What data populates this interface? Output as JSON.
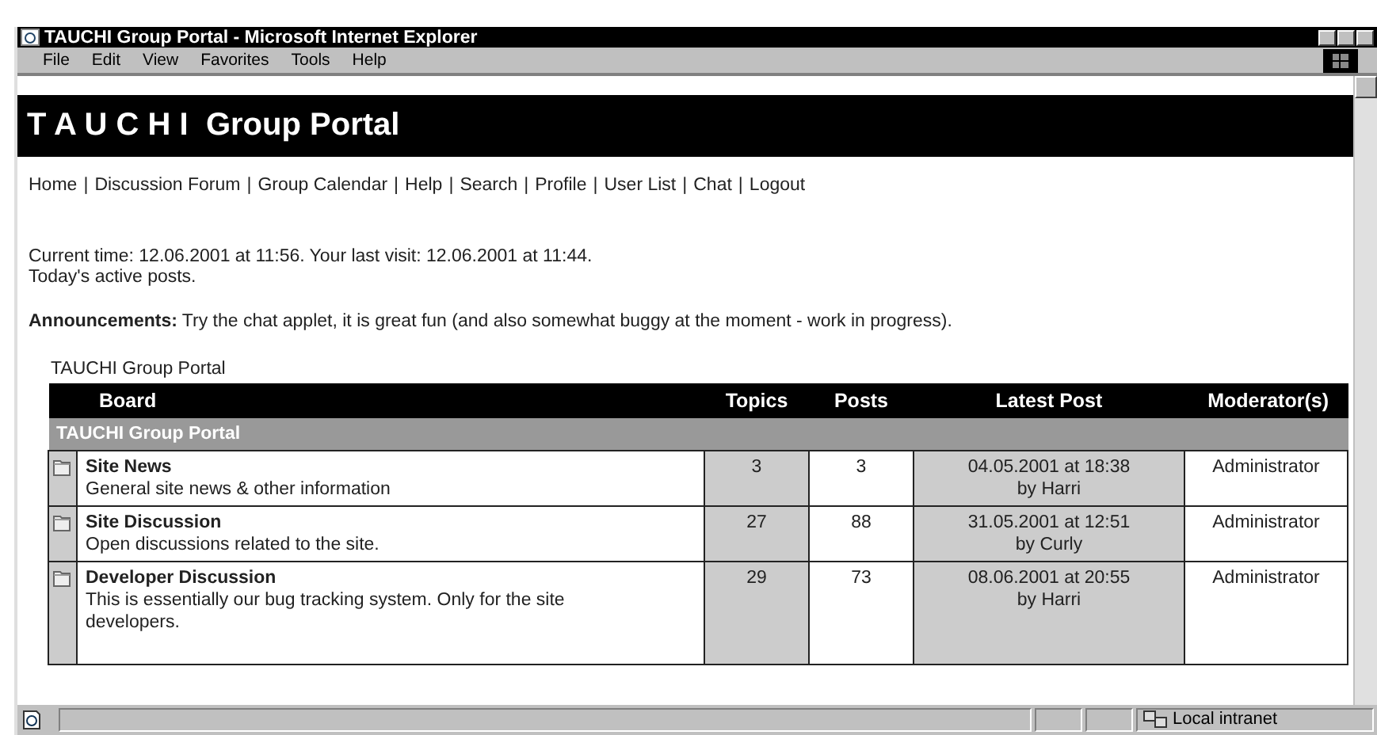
{
  "window": {
    "title": "TAUCHI Group Portal - Microsoft Internet Explorer"
  },
  "menu": [
    "File",
    "Edit",
    "View",
    "Favorites",
    "Tools",
    "Help"
  ],
  "page": {
    "header": "T A U C H I  Group Portal",
    "nav": {
      "separator": "|",
      "links": [
        "Home",
        "Discussion Forum",
        "Group Calendar",
        "Help",
        "Search",
        "Profile",
        "User List",
        "Chat",
        "Logout"
      ]
    },
    "current_time": "Current time: 12.06.2001 at 11:56. Your last visit: 12.06.2001 at 11:44.",
    "active_posts_link": "Today's active posts.",
    "announcement": "**Announcements:** Try the chat applet, it is great fun (and also somewhat buggy at the moment - work in progress).",
    "breadcrumb": "TAUCHI Group Portal",
    "table": {
      "columns": [
        "Board",
        "Topics",
        "Posts",
        "Latest Post",
        "Moderator(s)"
      ],
      "group": "TAUCHI Group Portal",
      "rows": [
        {
          "board": "Site News",
          "description": "General site news & other information",
          "topics": "3",
          "posts": "3",
          "latest_date": "04.05.2001 at 18:38",
          "latest_by": "by Harri",
          "moderator": "Administrator"
        },
        {
          "board": "Site Discussion",
          "description": "Open discussions related to the site.",
          "topics": "27",
          "posts": "88",
          "latest_date": "31.05.2001 at 12:51",
          "latest_by": "by Curly",
          "moderator": "Administrator"
        },
        {
          "board": "Developer Discussion",
          "description": "This is essentially our bug tracking system. Only for the site developers.",
          "topics": "29",
          "posts": "73",
          "latest_date": "08.06.2001 at 20:55",
          "latest_by": "by Harri",
          "moderator": "Administrator"
        }
      ]
    }
  },
  "status_bar": {
    "zone": "Local intranet"
  }
}
